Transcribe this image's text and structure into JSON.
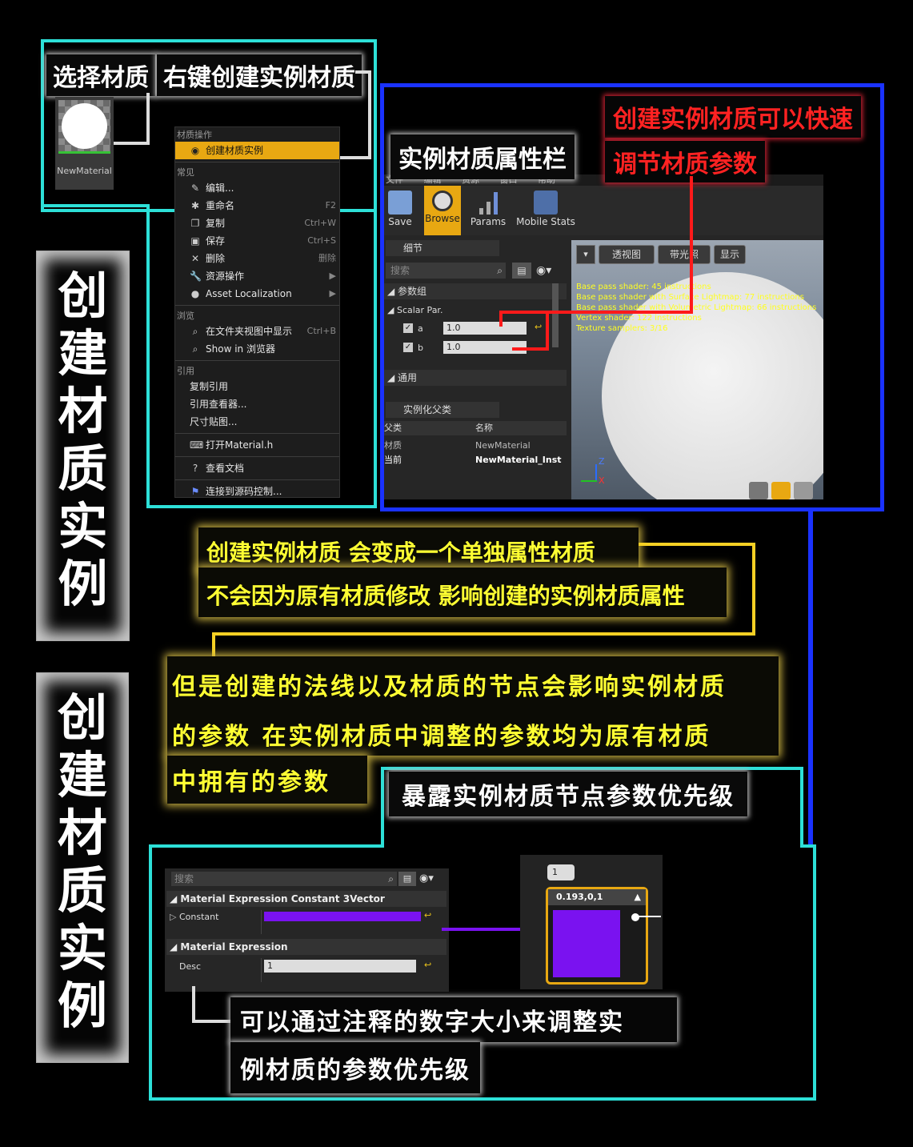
{
  "labels": {
    "select_material": "选择材质",
    "right_click_create": "右键创建实例材质",
    "instance_panel": "实例材质属性栏",
    "red_note_line1": "创建实例材质可以快速",
    "red_note_line2": "调节材质参数",
    "expose_priority": "暴露实例材质节点参数优先级"
  },
  "side_titles": [
    {
      "chars": [
        "创",
        "建",
        "材",
        "质",
        "实",
        "例"
      ]
    },
    {
      "chars": [
        "创",
        "建",
        "材",
        "质",
        "实",
        "例"
      ]
    }
  ],
  "asset": {
    "name": "NewMaterial"
  },
  "context_menu": {
    "sections": [
      {
        "header": "材质操作",
        "items": [
          {
            "label": "创建材质实例",
            "icon": "instance-icon",
            "shortcut": "",
            "highlight": true
          }
        ]
      },
      {
        "header": "常见",
        "items": [
          {
            "label": "编辑...",
            "icon": "edit-icon",
            "shortcut": ""
          },
          {
            "label": "重命名",
            "icon": "rename-icon",
            "shortcut": "F2"
          },
          {
            "label": "复制",
            "icon": "duplicate-icon",
            "shortcut": "Ctrl+W"
          },
          {
            "label": "保存",
            "icon": "save-icon",
            "shortcut": "Ctrl+S"
          },
          {
            "label": "删除",
            "icon": "delete-icon",
            "shortcut": "删除"
          },
          {
            "label": "资源操作",
            "icon": "wrench-icon",
            "shortcut": "▶"
          },
          {
            "label": "Asset Localization",
            "icon": "globe-icon",
            "shortcut": "▶"
          }
        ]
      },
      {
        "header": "浏览",
        "items": [
          {
            "label": "在文件夹视图中显示",
            "icon": "search-icon",
            "shortcut": "Ctrl+B"
          },
          {
            "label": "Show in 浏览器",
            "icon": "search-icon",
            "shortcut": ""
          }
        ]
      },
      {
        "header": "引用",
        "items": [
          {
            "label": "复制引用",
            "icon": "",
            "shortcut": ""
          },
          {
            "label": "引用查看器...",
            "icon": "",
            "shortcut": ""
          },
          {
            "label": "尺寸贴图...",
            "icon": "",
            "shortcut": ""
          }
        ]
      },
      {
        "header": "",
        "items": [
          {
            "label": "打开Material.h",
            "icon": "code-icon",
            "shortcut": ""
          }
        ]
      },
      {
        "header": "",
        "items": [
          {
            "label": "查看文档",
            "icon": "help-icon",
            "shortcut": ""
          }
        ]
      },
      {
        "header": "",
        "items": [
          {
            "label": "连接到源码控制...",
            "icon": "source-control-icon",
            "shortcut": ""
          }
        ]
      }
    ]
  },
  "editor": {
    "menu": [
      "文件",
      "编辑",
      "资源",
      "窗口",
      "帮助"
    ],
    "toolbar": [
      {
        "label": "Save",
        "icon": "save-icon"
      },
      {
        "label": "Browse",
        "icon": "browse-icon",
        "active": true
      },
      {
        "label": "Params",
        "icon": "params-icon"
      },
      {
        "label": "Mobile Stats",
        "icon": "mobile-stats-icon"
      }
    ],
    "details_tab": "细节",
    "search_placeholder": "搜索",
    "param_group": "参数组",
    "scalar_group": "Scalar Par.",
    "params": [
      {
        "name": "a",
        "value": "1.0"
      },
      {
        "name": "b",
        "value": "1.0"
      }
    ],
    "general": "通用",
    "parent_tab": "实例化父类",
    "parent_headers": [
      "父类",
      "名称"
    ],
    "parent_rows": [
      [
        "材质",
        "NewMaterial"
      ],
      [
        "当前",
        "NewMaterial_Inst"
      ]
    ],
    "viewport_buttons": [
      "透视图",
      "带光照",
      "显示"
    ],
    "stats": [
      "Base pass shader: 45 instructions",
      "Base pass shader with Surface Lightmap: 77 instructions",
      "Base pass shader with Volumetric Lightmap: 66 instructions",
      "Vertex shader: 122 instructions",
      "Texture samplers: 3/16"
    ],
    "axis": {
      "z": "Z",
      "x": "X"
    }
  },
  "yellow_notes": {
    "block1_line1": "创建实例材质  会变成一个单独属性材质",
    "block1_line2": "不会因为原有材质修改  影响创建的实例材质属性",
    "block2_line1": "但是创建的法线以及材质的节点会影响实例材质",
    "block2_line2": "的参数   在实例材质中调整的参数均为原有材质",
    "block2_line3": "中拥有的参数"
  },
  "bottom_panel": {
    "search_placeholder": "搜索",
    "section1": "Material Expression Constant 3Vector",
    "constant_label": "Constant",
    "section2": "Material Expression",
    "desc_label": "Desc",
    "desc_value": "1",
    "swatch_color": "#7a12f0"
  },
  "node": {
    "comment_value": "1",
    "title": "0.193,0,1",
    "color": "#7a12f0"
  },
  "bottom_note": {
    "line1": "可以通过注释的数字大小来调整实",
    "line2": "例材质的参数优先级"
  },
  "colors": {
    "cyan": "#2de0d8",
    "blue": "#1a32ff",
    "red": "#ff1a1a",
    "yellow": "#ffff33",
    "highlight": "#e8a812"
  }
}
